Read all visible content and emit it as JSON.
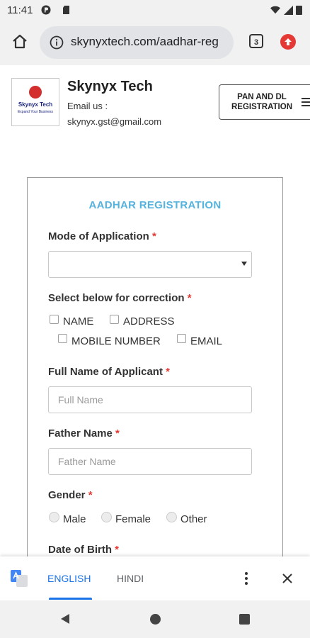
{
  "status_bar": {
    "time": "11:41",
    "icons": [
      "location-icon",
      "sd-card-icon",
      "wifi-icon",
      "signal-icon",
      "battery-icon"
    ]
  },
  "browser": {
    "url": "skynyxtech.com/aadhar-reg",
    "tab_count": "3",
    "icons": [
      "home-icon",
      "info-icon",
      "extension-icon"
    ]
  },
  "site_header": {
    "logo_name": "Skynyx Tech",
    "logo_tagline": "Expand Your Business",
    "title": "Skynyx Tech",
    "email_label": "Email us :",
    "email": "skynyx.gst@gmail.com",
    "nav_button_label": "PAN AND DL REGISTRATION"
  },
  "form": {
    "title": "AADHAR REGISTRATION",
    "required_marker": "*",
    "mode_label": "Mode of Application",
    "mode_value": "",
    "correction_label": "Select below for correction",
    "correction_options": [
      "NAME",
      "ADDRESS",
      "MOBILE NUMBER",
      "EMAIL"
    ],
    "full_name_label": "Full Name of Applicant",
    "full_name_placeholder": "Full Name",
    "father_name_label": "Father Name",
    "father_name_placeholder": "Father Name",
    "gender_label": "Gender",
    "gender_options": [
      "Male",
      "Female",
      "Other"
    ],
    "dob_label": "Date of Birth"
  },
  "translate_bar": {
    "tab_english": "ENGLISH",
    "tab_hindi": "HINDI",
    "active_tab": "ENGLISH",
    "accent_color": "#1a73e8"
  },
  "colors": {
    "form_title": "#56b3dd",
    "required": "#e53935"
  }
}
